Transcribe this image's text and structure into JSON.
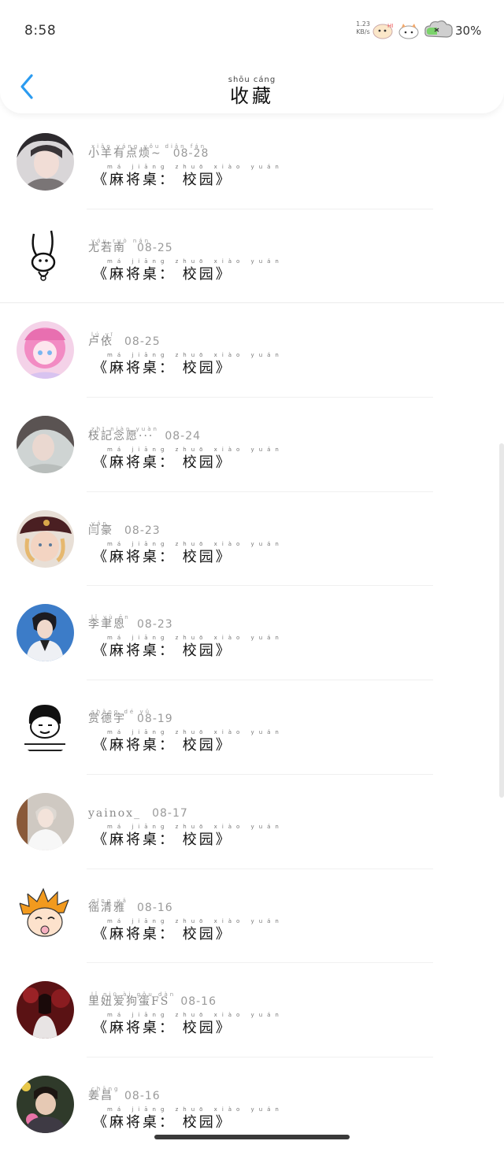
{
  "status": {
    "time": "8:58",
    "net_speed": "1.23",
    "net_unit": "KB/s",
    "battery": "30%"
  },
  "header": {
    "title": "收藏",
    "title_pinyin": "shōu cáng"
  },
  "game_title": "《麻将桌： 校园》",
  "game_pinyin": "má jiāng zhuō   xiào yuán",
  "colors": {
    "accent": "#2b9bf0",
    "text_dark": "#111111",
    "text_muted": "#8a8a8a"
  },
  "items": [
    {
      "name": "小羊有点烦~",
      "pinyin": "xiǎo yáng yǒu diǎn fán",
      "date": "08-28",
      "avatar": "girl-portrait-avatar"
    },
    {
      "name": "尤若南",
      "pinyin": "yóu ruò nán",
      "date": "08-25",
      "avatar": "rabbit-drawing-avatar"
    },
    {
      "name": "卢依",
      "pinyin": "lú yī",
      "date": "08-25",
      "avatar": "pink-anime-avatar"
    },
    {
      "name": "枝記念愿···",
      "pinyin": "zhī niàn yuàn",
      "date": "08-24",
      "avatar": "girl-photo-avatar"
    },
    {
      "name": "闫豪",
      "pinyin": "yán",
      "date": "08-23",
      "avatar": "cap-child-avatar"
    },
    {
      "name": "李聿恩",
      "pinyin": "lǐ yù ēn",
      "date": "08-23",
      "avatar": "stage-boy-avatar"
    },
    {
      "name": "赏德宇",
      "pinyin": "shǎng dé yǔ",
      "date": "08-19",
      "avatar": "meme-face-avatar"
    },
    {
      "name": "yainox_",
      "pinyin": "",
      "date": "08-17",
      "avatar": "white-hoodie-avatar"
    },
    {
      "name": "徭清雅",
      "pinyin": "qīng yǎ",
      "date": "08-16",
      "avatar": "cartoon-kid-avatar"
    },
    {
      "name": "里妞爱狗蛋FS",
      "pinyin": "lǐ niū ài gǒu dàn",
      "date": "08-16",
      "avatar": "red-dark-avatar"
    },
    {
      "name": "姜昌",
      "pinyin": "chāng",
      "date": "08-16",
      "avatar": "boy-flower-avatar"
    }
  ]
}
